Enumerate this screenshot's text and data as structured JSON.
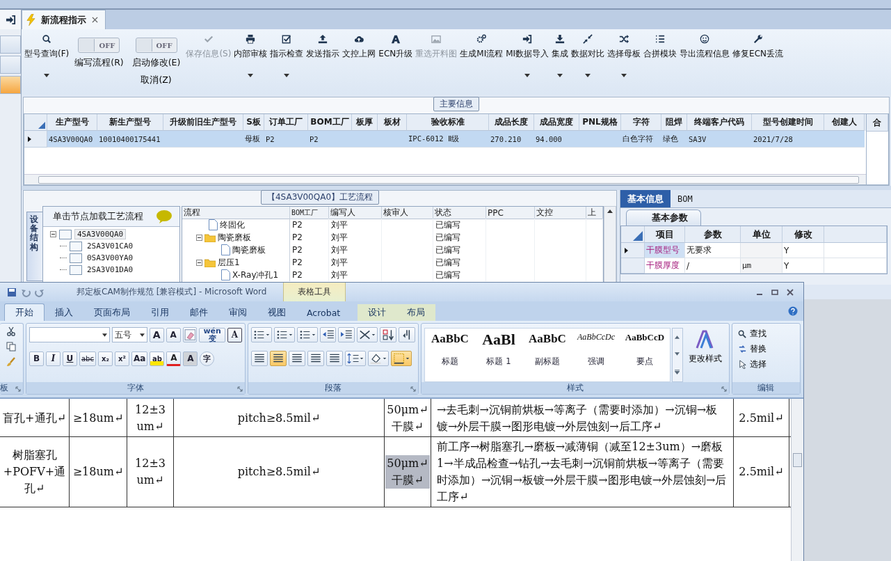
{
  "tab_bar": {
    "tabs": [
      {
        "label": "新流程指示",
        "selected": true
      }
    ]
  },
  "toolbar": [
    {
      "kind": "button",
      "label": "型号查询(F)",
      "dropdown": true,
      "disabled": false
    },
    {
      "kind": "toggle",
      "label": "编写流程(R)",
      "switch_text": "OFF",
      "on": false
    },
    {
      "kind": "toggle",
      "label": "启动修改(E)",
      "sublabel": "取消(Z)",
      "switch_text": "OFF",
      "on": false
    },
    {
      "kind": "button",
      "label": "保存信息(S)",
      "dropdown": false,
      "disabled": true
    },
    {
      "kind": "button",
      "label": "内部审核",
      "dropdown": true,
      "disabled": false
    },
    {
      "kind": "button",
      "label": "指示检查",
      "dropdown": true,
      "disabled": false
    },
    {
      "kind": "button",
      "label": "发送指示",
      "dropdown": false,
      "disabled": false
    },
    {
      "kind": "button",
      "label": "文控上网",
      "dropdown": false,
      "disabled": false
    },
    {
      "kind": "button",
      "label": "ECN升级",
      "dropdown": false,
      "disabled": false
    },
    {
      "kind": "button",
      "label": "重选开料图",
      "dropdown": false,
      "disabled": true
    },
    {
      "kind": "button",
      "label": "生成MI流程",
      "dropdown": false,
      "disabled": false
    },
    {
      "kind": "button",
      "label": "MI数据导入",
      "dropdown": true,
      "disabled": false
    },
    {
      "kind": "button",
      "label": "集成",
      "dropdown": true,
      "disabled": false
    },
    {
      "kind": "button",
      "label": "数据对比",
      "dropdown": true,
      "disabled": false
    },
    {
      "kind": "button",
      "label": "选择母板",
      "dropdown": true,
      "disabled": false
    },
    {
      "kind": "button",
      "label": "合拼模块",
      "dropdown": false,
      "disabled": false
    },
    {
      "kind": "button",
      "label": "导出流程信息",
      "dropdown": false,
      "disabled": false
    },
    {
      "kind": "button",
      "label": "修复ECN丢流",
      "dropdown": false,
      "disabled": false
    }
  ],
  "main_info": {
    "title": "主要信息",
    "columns": [
      "生产型号",
      "新生产型号",
      "升级前旧生产型号",
      "S板",
      "订单工厂",
      "BOM工厂",
      "板厚",
      "板材",
      "验收标准",
      "成品长度",
      "成品宽度",
      "PNL规格",
      "字符",
      "阻焊",
      "终端客户代码",
      "型号创建时间",
      "创建人"
    ],
    "rows": [
      {
        "selected": true,
        "cells": [
          "4SA3V00QA0",
          "10010400175441",
          "",
          "母板",
          "P2",
          "P2",
          "",
          "",
          "IPC-6012 Ⅱ级",
          "270.210",
          "94.000",
          "",
          "白色字符",
          "绿色",
          "SA3V",
          "2021/7/28",
          ""
        ]
      }
    ],
    "side_column": "合"
  },
  "process": {
    "title": "【4SA3V00QA0】工艺流程",
    "side_tab": "设备结构",
    "tree_header": "单击节点加载工艺流程",
    "tree": [
      {
        "label": "4SA3V00QA0",
        "expanded": true,
        "selected": true,
        "children": [
          {
            "label": "2SA3V01CA0",
            "selected": false
          },
          {
            "label": "0SA3V00YA0",
            "selected": false
          },
          {
            "label": "2SA3V01DA0",
            "selected": false
          }
        ]
      }
    ],
    "columns": [
      "流程",
      "BOM工厂",
      "编写人",
      "核审人",
      "状态",
      "PPC",
      "文控",
      "上"
    ],
    "rows": [
      {
        "name": "终固化",
        "kind": "step",
        "bom": "P2",
        "author": "刘平",
        "status": "已编写"
      },
      {
        "name": "陶瓷磨板",
        "kind": "group",
        "expanded": true,
        "bom": "P2",
        "author": "刘平",
        "status": "已编写",
        "children": [
          {
            "name": "陶瓷磨板",
            "kind": "step",
            "bom": "P2",
            "author": "刘平",
            "status": "已编写"
          }
        ]
      },
      {
        "name": "层压1",
        "kind": "group",
        "expanded": true,
        "bom": "P2",
        "author": "刘平",
        "status": "已编写",
        "children": [
          {
            "name": "X-Ray冲孔1",
            "kind": "step",
            "bom": "P2",
            "author": "刘平",
            "status": "已编写"
          }
        ]
      }
    ]
  },
  "basic_info": {
    "tabs": [
      {
        "label": "基本信息",
        "selected": true
      },
      {
        "label": "BOM",
        "selected": false
      }
    ],
    "sub_tab": "基本参数",
    "columns": [
      "项目",
      "参数",
      "单位",
      "修改"
    ],
    "rows": [
      {
        "item": "干膜型号",
        "param": "无要求",
        "unit": "",
        "modify": "Y",
        "selected": true
      },
      {
        "item": "干膜厚度",
        "param": "/",
        "unit": "μm",
        "modify": "Y",
        "selected": false
      }
    ]
  },
  "word": {
    "title": "邦定板CAM制作规范 [兼容模式] - Microsoft Word",
    "context_tab": "表格工具",
    "tabs": [
      {
        "label": "开始",
        "selected": true
      },
      {
        "label": "插入",
        "selected": false
      },
      {
        "label": "页面布局",
        "selected": false
      },
      {
        "label": "引用",
        "selected": false
      },
      {
        "label": "邮件",
        "selected": false
      },
      {
        "label": "审阅",
        "selected": false
      },
      {
        "label": "视图",
        "selected": false
      },
      {
        "label": "Acrobat",
        "selected": false
      },
      {
        "label": "设计",
        "selected": false
      },
      {
        "label": "布局",
        "selected": false
      }
    ],
    "groups": [
      "板",
      "字体",
      "段落",
      "样式",
      "编辑"
    ],
    "font_size": "五号",
    "font_row1": [
      "A",
      "A",
      "wén变",
      "A"
    ],
    "font_row2": [
      "B",
      "I",
      "U",
      "abc",
      "x₂",
      "x²",
      "Aa",
      "ab",
      "A",
      "A",
      "字"
    ],
    "styles": [
      {
        "preview": "AaBbC",
        "label": "标题",
        "kind": "bold"
      },
      {
        "preview": "AaBl",
        "label": "标题 1",
        "kind": "large"
      },
      {
        "preview": "AaBbC",
        "label": "副标题",
        "kind": "bold"
      },
      {
        "preview": "AaBbCcDc",
        "label": "强调",
        "kind": "italic"
      },
      {
        "preview": "AaBbCcD",
        "label": "要点",
        "kind": "small"
      }
    ],
    "change_styles": "更改样式",
    "editing": [
      "查找",
      "替换",
      "选择"
    ],
    "table_rows": [
      {
        "type": "盲孔+通孔↵",
        "copper": "≥18um↵",
        "thickness": "12±3 um↵",
        "pitch": "pitch≥8.5mil↵",
        "film": {
          "text": "50μm↵ 干膜↵",
          "selected": false
        },
        "process": "→去毛刺→沉铜前烘板→等离子（需要时添加）→沉铜→板镀→外层干膜→图形电镀→外层蚀刻→后工序↵",
        "spacing": "2.5mil↵"
      },
      {
        "type": "树脂塞孔+POFV+通孔↵",
        "copper": "≥18um↵",
        "thickness": "12±3 um↵",
        "pitch": "pitch≥8.5mil↵",
        "film": {
          "text": "50μm↵ 干膜↵",
          "selected": true
        },
        "process": "前工序→树脂塞孔→磨板→减薄铜（减至12±3um）→磨板 1→半成品检查→钻孔→去毛刺→沉铜前烘板→等离子（需要时添加）→沉铜→板镀→外层干膜→图形电镀→外层蚀刻→后工序↵",
        "spacing": "2.5mil↵"
      }
    ]
  }
}
